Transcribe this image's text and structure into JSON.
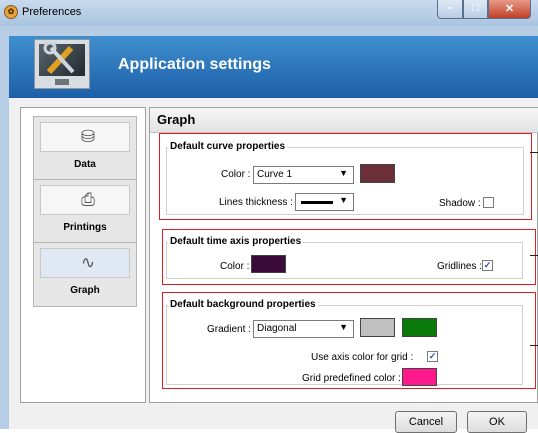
{
  "window": {
    "title": "Preferences",
    "minimize_glyph": "–",
    "maximize_glyph": "□",
    "close_glyph": "✕"
  },
  "header": {
    "title": "Application settings",
    "icon": "tools-monitor-icon"
  },
  "sidebar": {
    "items": [
      {
        "label": "Data",
        "icon": "database-icon",
        "glyph": "⛁"
      },
      {
        "label": "Printings",
        "icon": "printer-icon",
        "glyph": "⎙"
      },
      {
        "label": "Graph",
        "icon": "graph-icon",
        "glyph": "∿"
      }
    ]
  },
  "content": {
    "title": "Graph",
    "curve": {
      "title": "Default curve properties",
      "color_label": "Color :",
      "color_value": "Curve 1",
      "swatch": "#6b2f3a",
      "thickness_label": "Lines thickness :",
      "shadow_label": "Shadow :",
      "shadow_checked": false
    },
    "time_axis": {
      "title": "Default time axis properties",
      "color_label": "Color :",
      "swatch": "#3a0a3a",
      "gridlines_label": "Gridlines :",
      "gridlines_checked": true,
      "check_glyph": "✓"
    },
    "background": {
      "title": "Default background properties",
      "gradient_label": "Gradient :",
      "gradient_value": "Diagonal",
      "swatch_1": "#c0c0c0",
      "swatch_2": "#0a7a0a",
      "axis_color_label": "Use axis color for grid :",
      "axis_color_checked": true,
      "check_glyph": "✓",
      "grid_color_label": "Grid predefined color :",
      "grid_swatch": "#ff1a8c"
    }
  },
  "footer": {
    "cancel_label": "Cancel",
    "ok_label": "OK"
  },
  "colors": {
    "highlight_border": "#e02020",
    "header_blue": "#1c5fa8"
  }
}
